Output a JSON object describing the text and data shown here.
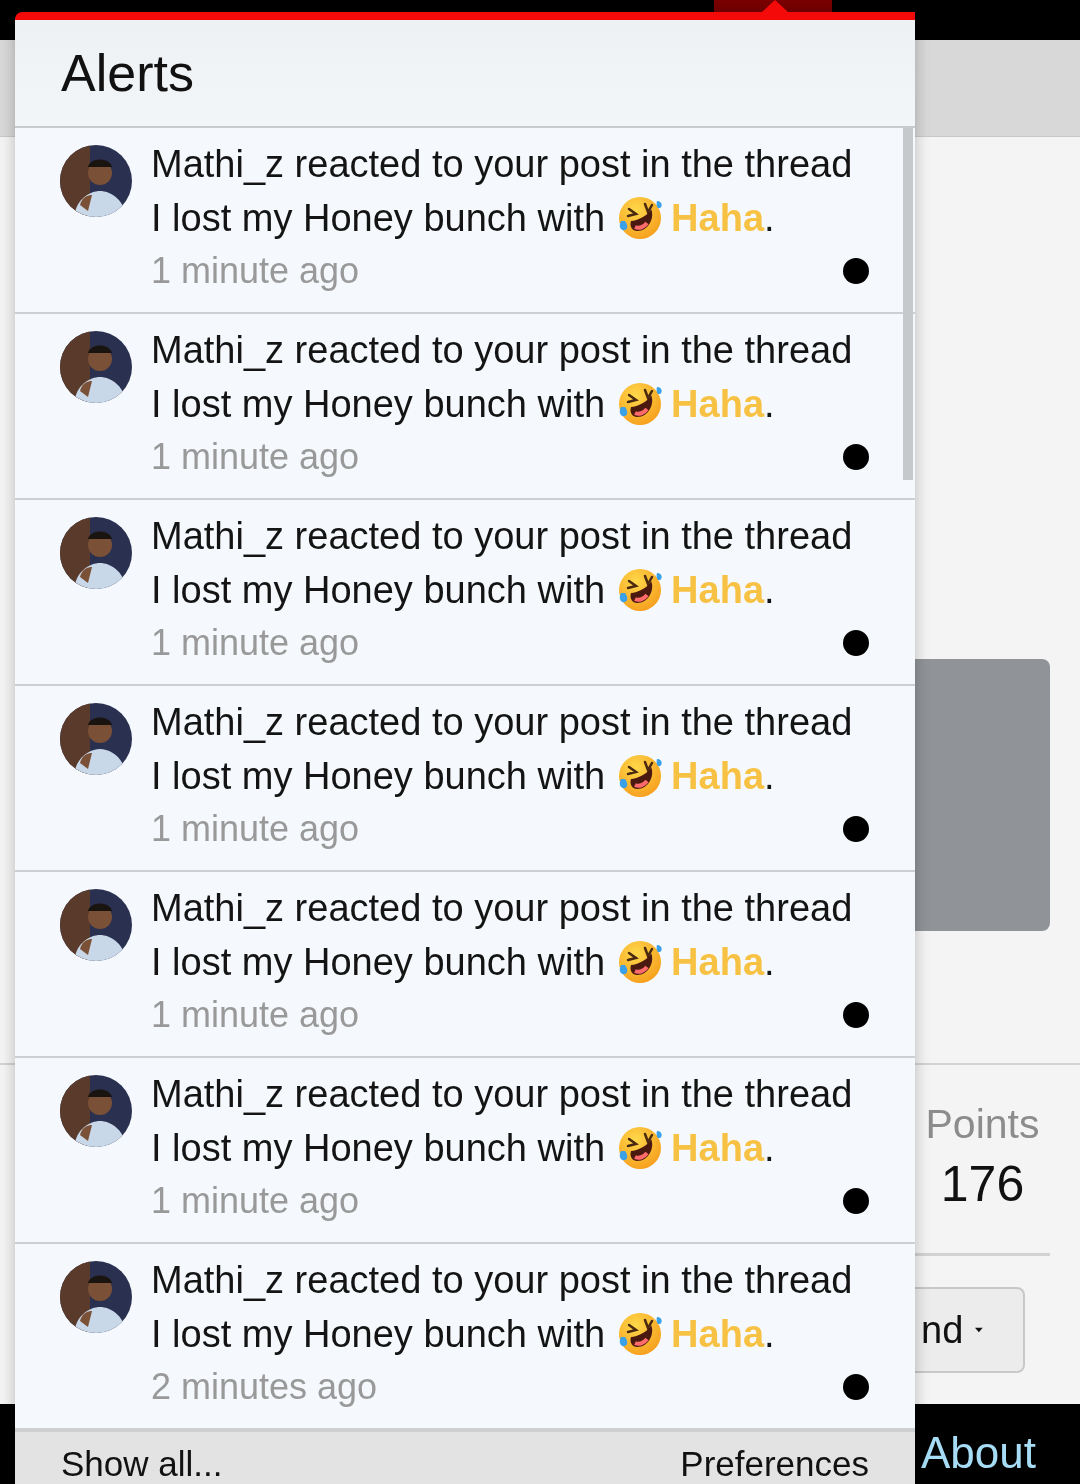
{
  "page": {
    "points_label": "Points",
    "points_value": "176",
    "button_label": "nd",
    "footer_link": "About"
  },
  "alerts": {
    "title": "Alerts",
    "items": [
      {
        "user": "Mathi_z",
        "action": "reacted to your post in the thread",
        "thread": "I lost my Honey bunch",
        "with": "with",
        "reaction": "Haha",
        "end": ".",
        "time": "1 minute ago",
        "unread": true
      },
      {
        "user": "Mathi_z",
        "action": "reacted to your post in the thread",
        "thread": "I lost my Honey bunch",
        "with": "with",
        "reaction": "Haha",
        "end": ".",
        "time": "1 minute ago",
        "unread": true
      },
      {
        "user": "Mathi_z",
        "action": "reacted to your post in the thread",
        "thread": "I lost my Honey bunch",
        "with": "with",
        "reaction": "Haha",
        "end": ".",
        "time": "1 minute ago",
        "unread": true
      },
      {
        "user": "Mathi_z",
        "action": "reacted to your post in the thread",
        "thread": "I lost my Honey bunch",
        "with": "with",
        "reaction": "Haha",
        "end": ".",
        "time": "1 minute ago",
        "unread": true
      },
      {
        "user": "Mathi_z",
        "action": "reacted to your post in the thread",
        "thread": "I lost my Honey bunch",
        "with": "with",
        "reaction": "Haha",
        "end": ".",
        "time": "1 minute ago",
        "unread": true
      },
      {
        "user": "Mathi_z",
        "action": "reacted to your post in the thread",
        "thread": "I lost my Honey bunch",
        "with": "with",
        "reaction": "Haha",
        "end": ".",
        "time": "1 minute ago",
        "unread": true
      },
      {
        "user": "Mathi_z",
        "action": "reacted to your post in the thread",
        "thread": "I lost my Honey bunch",
        "with": "with",
        "reaction": "Haha",
        "end": ".",
        "time": "2 minutes ago",
        "unread": true
      }
    ],
    "show_all": "Show all...",
    "preferences": "Preferences"
  }
}
